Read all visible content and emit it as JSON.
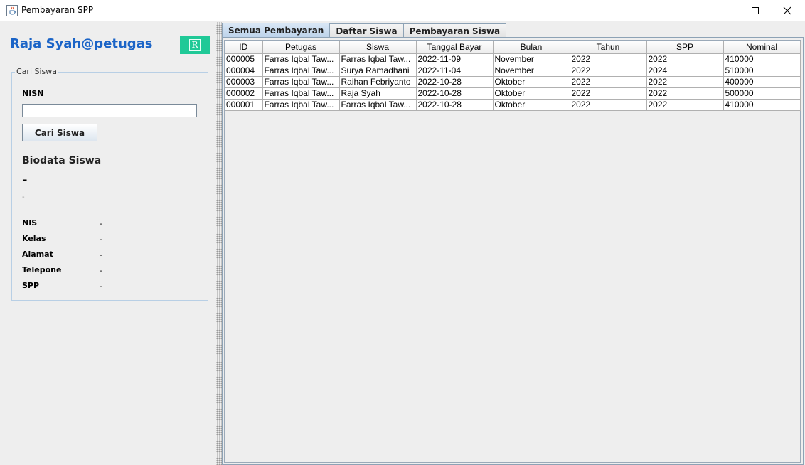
{
  "window": {
    "title": "Pembayaran SPP",
    "icon": "java-cup-icon"
  },
  "left_panel": {
    "user_title": "Raja Syah@petugas",
    "r_button_label": "R",
    "group_title": "Cari Siswa",
    "nisn_label": "NISN",
    "nisn_value": "",
    "search_button": "Cari Siswa",
    "biodata_title": "Biodata Siswa",
    "student_name": "-",
    "student_sub": "-",
    "fields": [
      {
        "label": "NIS",
        "value": "-"
      },
      {
        "label": "Kelas",
        "value": "-"
      },
      {
        "label": "Alamat",
        "value": "-"
      },
      {
        "label": "Telepone",
        "value": "-"
      },
      {
        "label": "SPP",
        "value": "-"
      }
    ],
    "accent_color": "#20c997",
    "title_color": "#1b64c7"
  },
  "tabs": [
    {
      "label": "Semua Pembayaran",
      "active": true
    },
    {
      "label": "Daftar Siswa",
      "active": false
    },
    {
      "label": "Pembayaran Siswa",
      "active": false
    }
  ],
  "table": {
    "columns": [
      "ID",
      "Petugas",
      "Siswa",
      "Tanggal Bayar",
      "Bulan",
      "Tahun",
      "SPP",
      "Nominal"
    ],
    "rows": [
      [
        "000005",
        "Farras Iqbal Taw...",
        "Farras Iqbal Taw...",
        "2022-11-09",
        "November",
        "2022",
        "2022",
        "410000"
      ],
      [
        "000004",
        "Farras Iqbal Taw...",
        "Surya Ramadhani",
        "2022-11-04",
        "November",
        "2022",
        "2024",
        "510000"
      ],
      [
        "000003",
        "Farras Iqbal Taw...",
        "Raihan Febriyanto",
        "2022-10-28",
        "Oktober",
        "2022",
        "2022",
        "400000"
      ],
      [
        "000002",
        "Farras Iqbal Taw...",
        "Raja Syah",
        "2022-10-28",
        "Oktober",
        "2022",
        "2022",
        "500000"
      ],
      [
        "000001",
        "Farras Iqbal Taw...",
        "Farras Iqbal Taw...",
        "2022-10-28",
        "Oktober",
        "2022",
        "2022",
        "410000"
      ]
    ]
  }
}
